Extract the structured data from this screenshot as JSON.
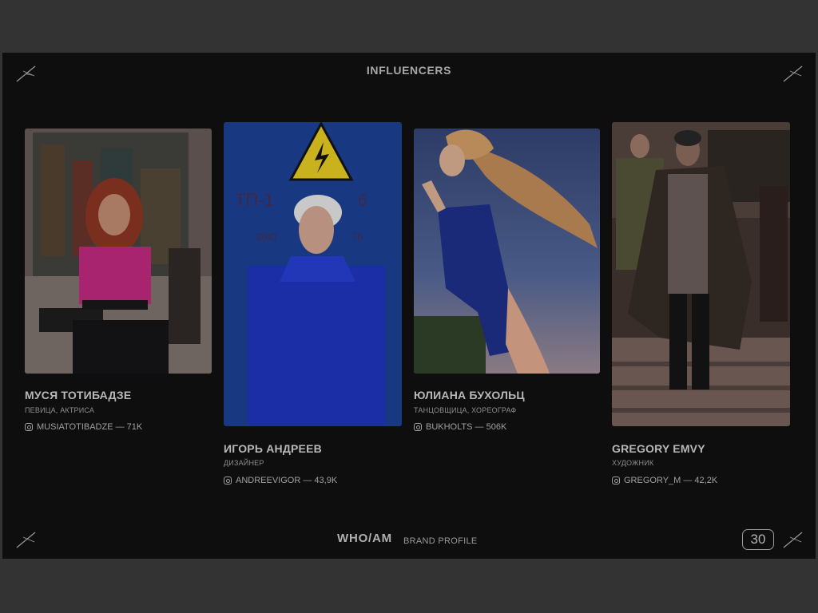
{
  "slide": {
    "title": "INFLUENCERS",
    "footer_brand": "WHO/AM",
    "footer_subtitle": "BRAND PROFILE",
    "page_number": "30"
  },
  "influencers": [
    {
      "name": "МУСЯ ТОТИБАДЗЕ",
      "role": "ПЕВИЦА, АКТРИСА",
      "instagram": "MUSIATOTIBADZE — 71K",
      "photo_subject": "woman with red hair in pink top sitting with guitar"
    },
    {
      "name": "ИГОРЬ АНДРЕЕВ",
      "role": "ДИЗАЙНЕР",
      "instagram": "ANDREEVIGOR — 43,9K",
      "photo_subject": "man with white hair in blue shirt against blue wall with warning sign"
    },
    {
      "name": "ЮЛИАНА БУХОЛЬЦ",
      "role": "ТАНЦОВЩИЦА, ХОРЕОГРАФ",
      "instagram": "BUKHOLTS — 506K",
      "photo_subject": "woman in blue swimsuit with flowing hair against sky"
    },
    {
      "name": "GREGORY EMVY",
      "role": "ХУДОЖНИК",
      "instagram": "GREGORY_M — 42,2K",
      "photo_subject": "man in long coat walking down steps"
    }
  ],
  "icons": {
    "corner": "sparkle-star-icon",
    "social": "instagram-icon"
  },
  "colors": {
    "background": "#333333",
    "slide": "#0e0e0e",
    "text": "#b3b3b3"
  }
}
